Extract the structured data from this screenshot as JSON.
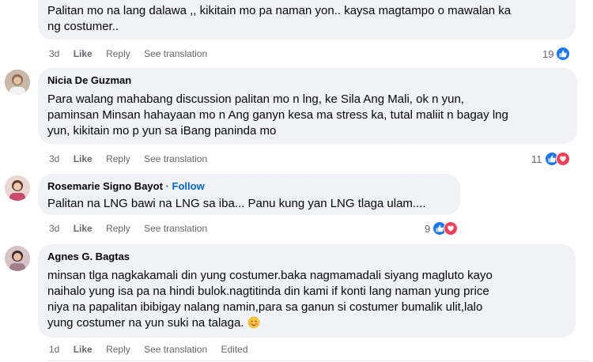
{
  "colors": {
    "bubble": "#f0f2f5",
    "like": "#1877f2",
    "love": "#f33e58",
    "meta": "#65676b",
    "follow": "#0064d1"
  },
  "comments": [
    {
      "text_lines": [
        "Palitan mo na lang dalawa ,, kikitain mo pa naman yon.. kaysa magtampo o mawalan ka",
        "ng costumer.."
      ],
      "time": "3d",
      "like": "Like",
      "reply": "Reply",
      "see_translation": "See translation",
      "reaction_count": "19",
      "reactions": [
        "like-icon"
      ]
    },
    {
      "author": "Nicia De Guzman",
      "text_lines": [
        "Para walang mahabang discussion palitan mo n lng, ke Sila Ang Mali, ok n yun,",
        "paminsan Minsan hahayaan mo n Ang ganyn kesa ma stress ka, tutal maliit n bagay lng",
        "yun, kikitain mo p yun sa iBang paninda mo"
      ],
      "time": "3d",
      "like": "Like",
      "reply": "Reply",
      "see_translation": "See translation",
      "reaction_count": "11",
      "reactions": [
        "like-icon",
        "love-icon"
      ]
    },
    {
      "author": "Rosemarie Signo Bayot",
      "follow_sep": "·",
      "follow": "Follow",
      "text_lines": [
        "Palitan na LNG bawi na LNG sa iba... Panu kung yan LNG tlaga ulam...."
      ],
      "time": "3d",
      "like": "Like",
      "reply": "Reply",
      "see_translation": "See translation",
      "reaction_count": "9",
      "reactions": [
        "like-icon",
        "love-icon"
      ]
    },
    {
      "author": "Agnes G. Bagtas",
      "text_lines": [
        "minsan tlga nagkakamali din yung costumer.baka nagmamadali siyang magluto kayo",
        "naihalo yung isa pa na hindi bulok.nagtitinda din kami if konti lang naman yung price",
        "niya na papalitan ibibigay nalang namin,para sa ganun si costumer bumalik ulit,lalo",
        "yung costumer na yun suki na talaga."
      ],
      "emoji": "smiling-blush-emoji",
      "time": "1d",
      "like": "Like",
      "reply": "Reply",
      "see_translation": "See translation",
      "edited": "Edited"
    }
  ]
}
